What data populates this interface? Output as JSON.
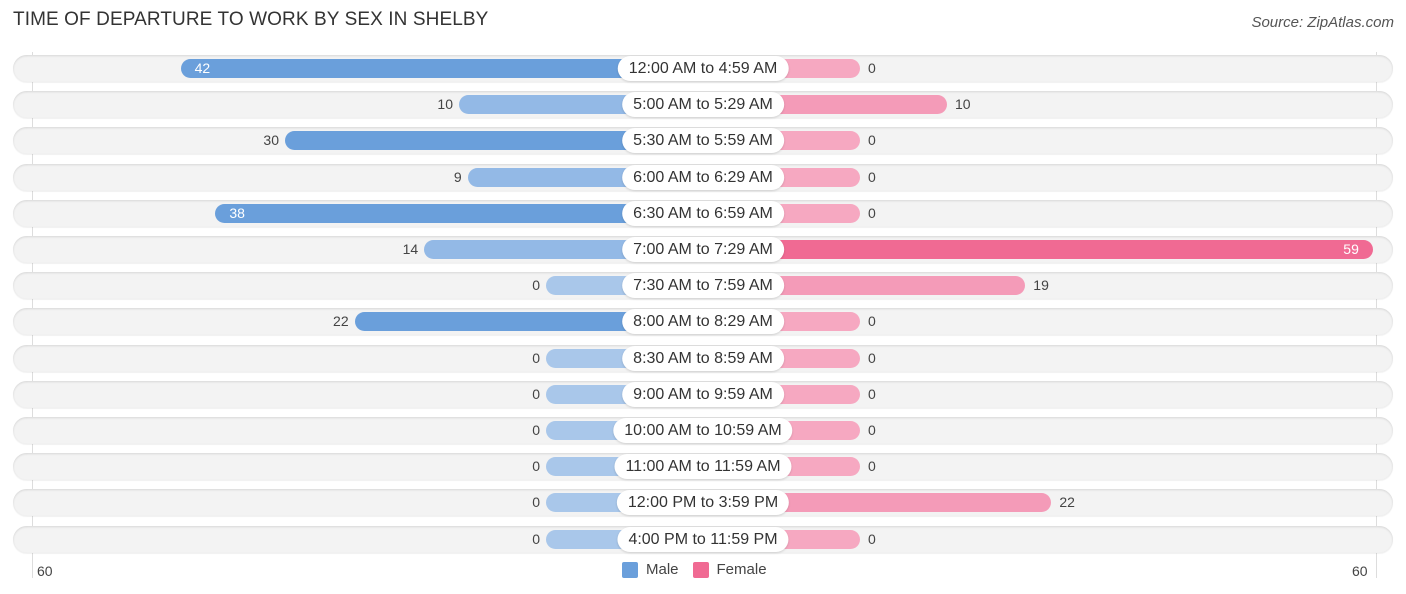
{
  "chart_data": {
    "type": "bar",
    "orientation": "horizontal-diverging",
    "title": "TIME OF DEPARTURE TO WORK BY SEX IN SHELBY",
    "source": "Source: ZipAtlas.com",
    "categories": [
      "12:00 AM to 4:59 AM",
      "5:00 AM to 5:29 AM",
      "5:30 AM to 5:59 AM",
      "6:00 AM to 6:29 AM",
      "6:30 AM to 6:59 AM",
      "7:00 AM to 7:29 AM",
      "7:30 AM to 7:59 AM",
      "8:00 AM to 8:29 AM",
      "8:30 AM to 8:59 AM",
      "9:00 AM to 9:59 AM",
      "10:00 AM to 10:59 AM",
      "11:00 AM to 11:59 AM",
      "12:00 PM to 3:59 PM",
      "4:00 PM to 11:59 PM"
    ],
    "series": [
      {
        "name": "Male",
        "color": "#6a9fdb",
        "values": [
          42,
          10,
          30,
          9,
          38,
          14,
          0,
          22,
          0,
          0,
          0,
          0,
          0,
          0
        ]
      },
      {
        "name": "Female",
        "color": "#f06a93",
        "values": [
          0,
          10,
          0,
          0,
          0,
          59,
          19,
          0,
          0,
          0,
          0,
          0,
          22,
          0
        ]
      }
    ],
    "axis": {
      "left_label": "60",
      "right_label": "60",
      "max": 60
    },
    "legend": {
      "position": "bottom-center",
      "items": [
        "Male",
        "Female"
      ]
    }
  }
}
